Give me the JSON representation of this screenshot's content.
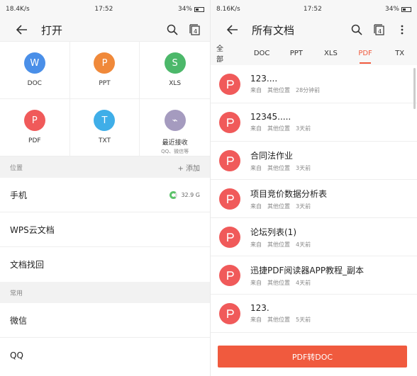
{
  "left": {
    "status": {
      "network": "18.4K/s",
      "time": "17:52",
      "battery": "34%"
    },
    "title": "打开",
    "tab_count": "4",
    "types": [
      {
        "icon": "W",
        "label": "DOC",
        "color": "#4a8fe8"
      },
      {
        "icon": "P",
        "label": "PPT",
        "color": "#f0893a"
      },
      {
        "icon": "S",
        "label": "XLS",
        "color": "#4cb86a"
      },
      {
        "icon": "P",
        "label": "PDF",
        "color": "#f05a5a"
      },
      {
        "icon": "T",
        "label": "TXT",
        "color": "#3faee8"
      },
      {
        "icon": "⌁",
        "label": "最近接收",
        "sub": "QQ、微信等",
        "color": "#a59bbf"
      }
    ],
    "location_header": "位置",
    "add_label": "+ 添加",
    "locations": [
      "手机",
      "WPS云文档",
      "文档找回"
    ],
    "phone_storage": "32.9 G",
    "common_header": "常用",
    "common": [
      "微信",
      "QQ"
    ]
  },
  "right": {
    "status": {
      "network": "8.16K/s",
      "time": "17:52",
      "battery": "34%"
    },
    "title": "所有文档",
    "tab_count": "4",
    "tabs": [
      "全部",
      "DOC",
      "PPT",
      "XLS",
      "PDF",
      "TX"
    ],
    "active_tab": "PDF",
    "files": [
      {
        "name": "123....",
        "from": "来自",
        "location": "其他位置",
        "time": "28分钟前"
      },
      {
        "name": "12345.....",
        "from": "来自",
        "location": "其他位置",
        "time": "3天前"
      },
      {
        "name": "合同法作业",
        "from": "来自",
        "location": "其他位置",
        "time": "3天前"
      },
      {
        "name": "项目竞价数据分析表",
        "from": "来自",
        "location": "其他位置",
        "time": "3天前"
      },
      {
        "name": "论坛列表(1)",
        "from": "来自",
        "location": "其他位置",
        "time": "4天前"
      },
      {
        "name": "迅捷PDF阅读器APP教程_副本",
        "from": "来自",
        "location": "其他位置",
        "time": "4天前"
      },
      {
        "name": "123.",
        "from": "来自",
        "location": "其他位置",
        "time": "5天前"
      }
    ],
    "convert_button": "PDF转DOC"
  },
  "colors": {
    "accent": "#f05a3e",
    "pdf": "#f05a5a"
  }
}
